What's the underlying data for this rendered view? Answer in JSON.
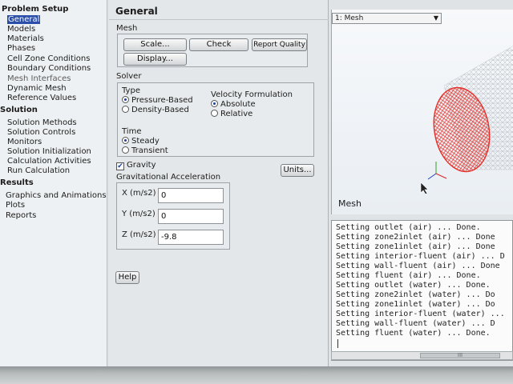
{
  "nav": {
    "problem_setup": "Problem Setup",
    "setup_items": [
      "General",
      "Models",
      "Materials",
      "Phases",
      "Cell Zone Conditions",
      "Boundary Conditions",
      "Mesh Interfaces",
      "Dynamic Mesh",
      "Reference Values"
    ],
    "solution": "Solution",
    "solution_items": [
      "Solution Methods",
      "Solution Controls",
      "Monitors",
      "Solution Initialization",
      "Calculation Activities",
      "Run Calculation"
    ],
    "results": "Results",
    "results_items": [
      "Graphics and Animations",
      "Plots",
      "Reports"
    ],
    "selected": "General"
  },
  "general": {
    "title": "General",
    "mesh_label": "Mesh",
    "scale_button": "Scale...",
    "check_button": "Check",
    "report_quality_button": "Report Quality",
    "display_button": "Display...",
    "solver_label": "Solver",
    "type_label": "Type",
    "type_options": [
      "Pressure-Based",
      "Density-Based"
    ],
    "type_selected": "Pressure-Based",
    "velocity_label": "Velocity Formulation",
    "velocity_options": [
      "Absolute",
      "Relative"
    ],
    "velocity_selected": "Absolute",
    "time_label": "Time",
    "time_options": [
      "Steady",
      "Transient"
    ],
    "time_selected": "Steady",
    "gravity_label": "Gravity",
    "gravity_checked": true,
    "units_button": "Units...",
    "grav_label": "Gravitational Acceleration",
    "x_label": "X (m/s2)",
    "x_value": "0",
    "y_label": "Y (m/s2)",
    "y_value": "0",
    "z_label": "Z (m/s2)",
    "z_value": "-9.8",
    "help_button": "Help"
  },
  "graphics": {
    "view_select": "1: Mesh",
    "caption": "Mesh",
    "mesh_color": "#e4312b"
  },
  "console": {
    "lines": [
      "Setting outlet (air) ... Done.",
      "Setting zone2inlet (air) ... Done",
      "Setting zone1inlet (air) ... Done",
      "Setting interior-fluent (air) ... D",
      "Setting wall-fluent (air) ... Done",
      "Setting fluent (air) ... Done.",
      "Setting outlet (water) ... Done.",
      "Setting zone2inlet (water) ... Do",
      "Setting zone1inlet (water) ... Do",
      "Setting interior-fluent (water) ...",
      "Setting wall-fluent (water) ... D",
      "Setting fluent (water) ... Done."
    ],
    "scroll_grip": "III"
  }
}
